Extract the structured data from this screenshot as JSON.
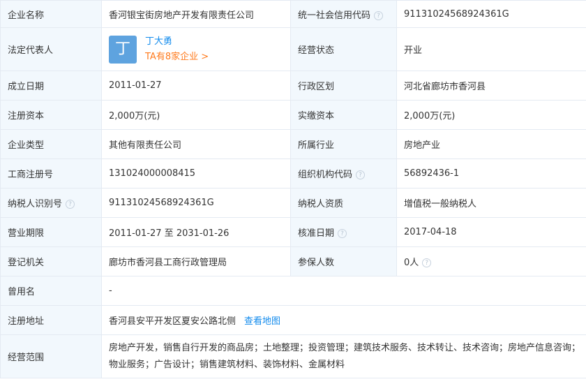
{
  "rows": [
    {
      "l1": "企业名称",
      "v1": "香河银宝街房地产开发有限责任公司",
      "l2": "统一社会信用代码",
      "v2": "91131024568924361G"
    },
    {
      "l1": "法定代表人",
      "v1_initial": "丁",
      "v1_name": "丁大勇",
      "v1_link": "TA有8家企业 >",
      "l2": "经营状态",
      "v2": "开业"
    },
    {
      "l1": "成立日期",
      "v1": "2011-01-27",
      "l2": "行政区划",
      "v2": "河北省廊坊市香河县"
    },
    {
      "l1": "注册资本",
      "v1": "2,000万(元)",
      "l2": "实缴资本",
      "v2": "2,000万(元)"
    },
    {
      "l1": "企业类型",
      "v1": "其他有限责任公司",
      "l2": "所属行业",
      "v2": "房地产业"
    },
    {
      "l1": "工商注册号",
      "v1": "131024000008415",
      "l2": "组织机构代码",
      "v2": "56892436-1"
    },
    {
      "l1": "纳税人识别号",
      "v1": "91131024568924361G",
      "l2": "纳税人资质",
      "v2": "增值税一般纳税人"
    },
    {
      "l1": "营业期限",
      "v1": "2011-01-27 至 2031-01-26",
      "l2": "核准日期",
      "v2": "2017-04-18"
    },
    {
      "l1": "登记机关",
      "v1": "廊坊市香河县工商行政管理局",
      "l2": "参保人数",
      "v2": "0人"
    },
    {
      "l1": "曾用名",
      "v1": "-"
    },
    {
      "l1": "注册地址",
      "v1": "香河县安平开发区夏安公路北侧",
      "link": "查看地图"
    },
    {
      "l1": "经营范围",
      "v1": "房地产开发，销售自行开发的商品房；土地整理；投资管理；建筑技术服务、技术转让、技术咨询；房地产信息咨询；物业服务；广告设计；销售建筑材料、装饰材料、金属材料"
    }
  ],
  "help_glyph": "?",
  "icons": {
    "help": "question-circle-icon"
  },
  "colors": {
    "label_bg": "#f2f8fd",
    "border": "#e4eaf2",
    "link": "#128bed",
    "orange_link": "#ff7a1c",
    "avatar_bg": "#5ea3df"
  }
}
